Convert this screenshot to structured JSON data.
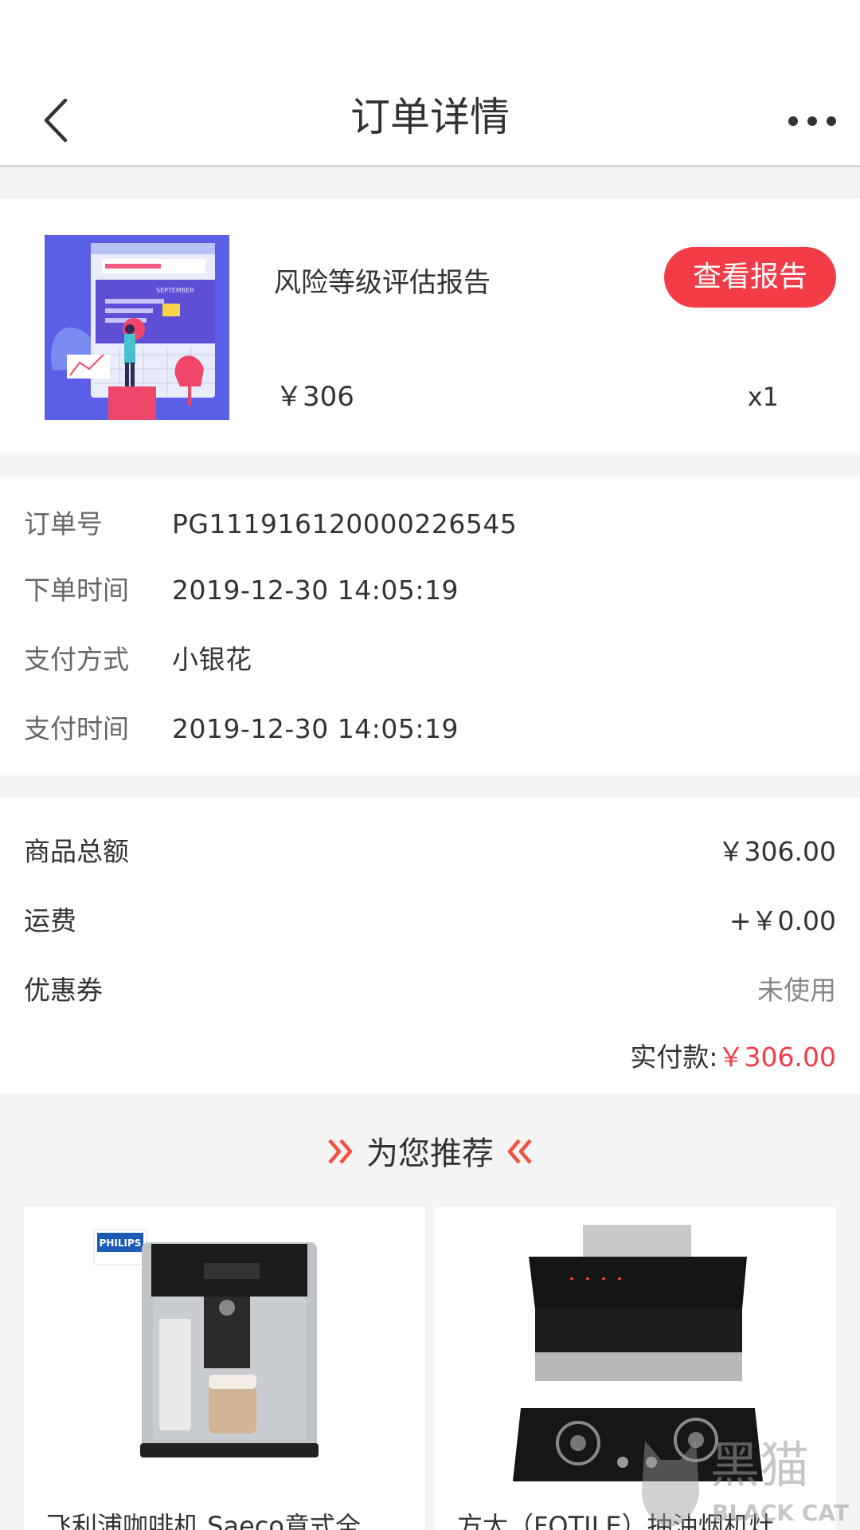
{
  "nav": {
    "title": "订单详情",
    "back_icon": "chevron-left-icon",
    "more_icon": "more-dots-icon"
  },
  "product": {
    "name": "风险等级评估报告",
    "button_label": "查看报告",
    "price": "￥306",
    "quantity": "x1",
    "thumbnail_text": "SEPTEMBER"
  },
  "order_info": [
    {
      "label": "订单号",
      "value": "PG111916120000226545"
    },
    {
      "label": "下单时间",
      "value": "2019-12-30 14:05:19"
    },
    {
      "label": "支付方式",
      "value": "小银花"
    },
    {
      "label": "支付时间",
      "value": "2019-12-30 14:05:19"
    }
  ],
  "summary": {
    "rows": [
      {
        "label": "商品总额",
        "value": "￥306.00"
      },
      {
        "label": "运费",
        "value": "+￥0.00"
      },
      {
        "label": "优惠券",
        "value": "未使用"
      }
    ],
    "paid_label": "实付款:",
    "paid_value": "￥306.00"
  },
  "recommend": {
    "title": "为您推荐",
    "items": [
      {
        "name": "飞利浦咖啡机 Saeco意式全",
        "brand": "PHILIPS"
      },
      {
        "name": "方太（FOTILE）抽油烟机灶",
        "brand": ""
      }
    ]
  },
  "watermark": {
    "cn": "黑猫",
    "en": "BLACK CAT"
  },
  "colors": {
    "accent": "#f33c48",
    "background": "#f4f4f4"
  }
}
